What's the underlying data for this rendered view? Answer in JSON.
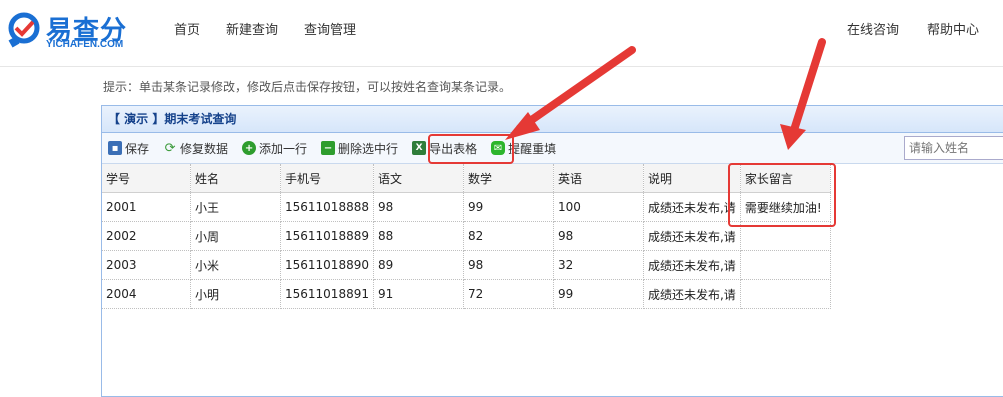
{
  "brand": {
    "name": "易查分",
    "sub": "YICHAFEN.COM"
  },
  "nav": {
    "left": [
      "首页",
      "新建查询",
      "查询管理"
    ],
    "right": [
      "在线咨询",
      "帮助中心"
    ]
  },
  "hint": "提示：单击某条记录修改，修改后点击保存按钮，可以按姓名查询某条记录。",
  "panel": {
    "title": "【 演示 】期末考试查询"
  },
  "toolbar": {
    "save": "保存",
    "repair": "修复数据",
    "add_row": "添加一行",
    "delete_rows": "删除选中行",
    "export": "导出表格",
    "remind": "提醒重填",
    "search_placeholder": "请输入姓名"
  },
  "table": {
    "columns": [
      "学号",
      "姓名",
      "手机号",
      "语文",
      "数学",
      "英语",
      "说明",
      "家长留言"
    ],
    "rows": [
      [
        "2001",
        "小王",
        "15611018888",
        "98",
        "99",
        "100",
        "成绩还未发布,请",
        "需要继续加油!"
      ],
      [
        "2002",
        "小周",
        "15611018889",
        "88",
        "82",
        "98",
        "成绩还未发布,请",
        ""
      ],
      [
        "2003",
        "小米",
        "15611018890",
        "89",
        "98",
        "32",
        "成绩还未发布,请",
        ""
      ],
      [
        "2004",
        "小明",
        "15611018891",
        "91",
        "72",
        "99",
        "成绩还未发布,请",
        ""
      ]
    ]
  },
  "colors": {
    "accent": "#1a6fd3",
    "highlight": "#e53935"
  },
  "icons": {
    "save": "save-icon",
    "repair": "refresh-icon",
    "add": "plus-icon",
    "delete": "minus-icon",
    "export": "excel-icon",
    "remind": "wechat-icon"
  }
}
